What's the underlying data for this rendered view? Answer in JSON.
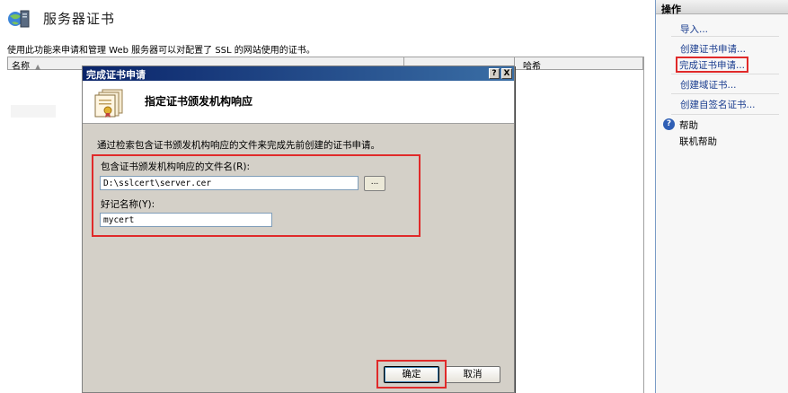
{
  "page": {
    "title": "服务器证书",
    "description": "使用此功能来申请和管理 Web 服务器可以对配置了 SSL 的网站使用的证书。",
    "columns": [
      "名称",
      "哈希"
    ]
  },
  "actions": {
    "header": "操作",
    "items": [
      "导入...",
      "创建证书申请...",
      "完成证书申请...",
      "创建域证书...",
      "创建自签名证书..."
    ],
    "help": [
      "帮助",
      "联机帮助"
    ]
  },
  "dialog": {
    "title": "完成证书申请",
    "title_buttons": [
      "?",
      "X"
    ],
    "heading": "指定证书颁发机构响应",
    "intro": "通过检索包含证书颁发机构响应的文件来完成先前创建的证书申请。",
    "file_label": "包含证书颁发机构响应的文件名(R):",
    "file_value": "D:\\sslcert\\server.cer",
    "browse_label": "...",
    "name_label": "好记名称(Y):",
    "name_value": "mycert",
    "ok_label": "确定",
    "cancel_label": "取消"
  },
  "colors": {
    "highlight": "#e02a2a",
    "titlebar": "#0a246a",
    "link": "#1a3d8f"
  }
}
